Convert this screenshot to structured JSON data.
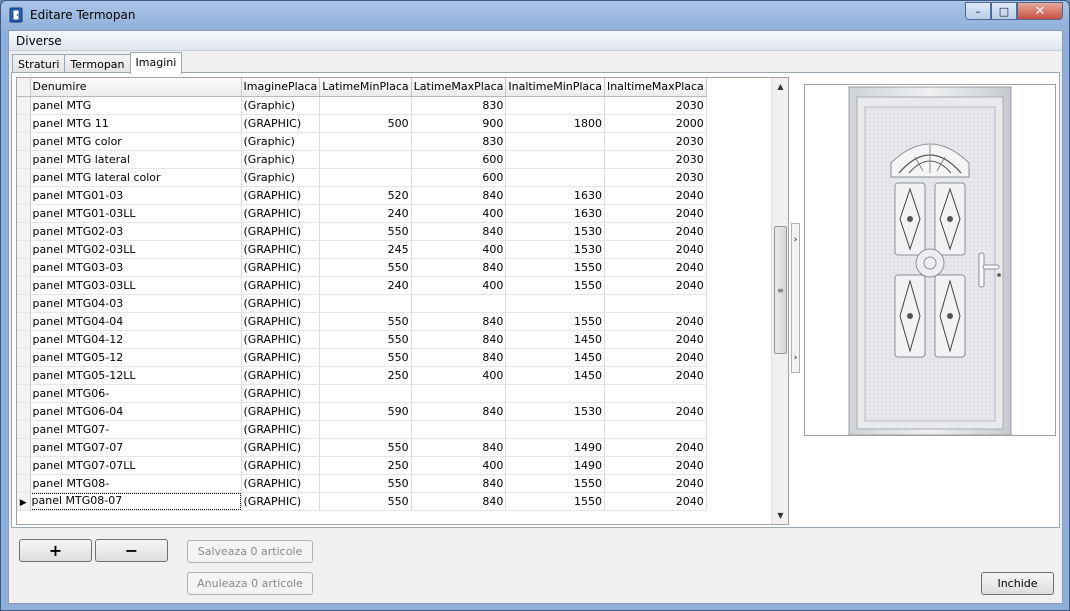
{
  "window": {
    "title": "Editare Termopan",
    "minimize_glyph": "–",
    "maximize_glyph": "□",
    "close_glyph": "✕"
  },
  "menu": {
    "items": [
      "Diverse"
    ]
  },
  "tabs": [
    {
      "label": "Straturi",
      "active": false
    },
    {
      "label": "Termopan",
      "active": false
    },
    {
      "label": "Imagini",
      "active": true
    }
  ],
  "grid": {
    "columns": [
      "Denumire",
      "ImaginePlaca",
      "LatimeMinPlaca",
      "LatimeMaxPlaca",
      "InaltimeMinPlaca",
      "InaltimeMaxPlaca"
    ],
    "selected_row": 22,
    "rows": [
      [
        "panel MTG",
        "(Graphic)",
        "",
        "830",
        "",
        "2030"
      ],
      [
        "panel MTG 11",
        "(GRAPHIC)",
        "500",
        "900",
        "1800",
        "2000"
      ],
      [
        "panel MTG color",
        "(Graphic)",
        "",
        "830",
        "",
        "2030"
      ],
      [
        "panel MTG lateral",
        "(Graphic)",
        "",
        "600",
        "",
        "2030"
      ],
      [
        "panel MTG lateral color",
        "(Graphic)",
        "",
        "600",
        "",
        "2030"
      ],
      [
        "panel MTG01-03",
        "(GRAPHIC)",
        "520",
        "840",
        "1630",
        "2040"
      ],
      [
        "panel MTG01-03LL",
        "(GRAPHIC)",
        "240",
        "400",
        "1630",
        "2040"
      ],
      [
        "panel MTG02-03",
        "(GRAPHIC)",
        "550",
        "840",
        "1530",
        "2040"
      ],
      [
        "panel MTG02-03LL",
        "(GRAPHIC)",
        "245",
        "400",
        "1530",
        "2040"
      ],
      [
        "panel MTG03-03",
        "(GRAPHIC)",
        "550",
        "840",
        "1550",
        "2040"
      ],
      [
        "panel MTG03-03LL",
        "(GRAPHIC)",
        "240",
        "400",
        "1550",
        "2040"
      ],
      [
        "panel MTG04-03",
        "(GRAPHIC)",
        "",
        "",
        "",
        ""
      ],
      [
        "panel MTG04-04",
        "(GRAPHIC)",
        "550",
        "840",
        "1550",
        "2040"
      ],
      [
        "panel MTG04-12",
        "(GRAPHIC)",
        "550",
        "840",
        "1450",
        "2040"
      ],
      [
        "panel MTG05-12",
        "(GRAPHIC)",
        "550",
        "840",
        "1450",
        "2040"
      ],
      [
        "panel MTG05-12LL",
        "(GRAPHIC)",
        "250",
        "400",
        "1450",
        "2040"
      ],
      [
        "panel MTG06-",
        "(GRAPHIC)",
        "",
        "",
        "",
        ""
      ],
      [
        "panel MTG06-04",
        "(GRAPHIC)",
        "590",
        "840",
        "1530",
        "2040"
      ],
      [
        "panel MTG07-",
        "(GRAPHIC)",
        "",
        "",
        "",
        ""
      ],
      [
        "panel MTG07-07",
        "(GRAPHIC)",
        "550",
        "840",
        "1490",
        "2040"
      ],
      [
        "panel MTG07-07LL",
        "(GRAPHIC)",
        "250",
        "400",
        "1490",
        "2040"
      ],
      [
        "panel MTG08-",
        "(GRAPHIC)",
        "550",
        "840",
        "1550",
        "2040"
      ],
      [
        "panel MTG08-07",
        "(GRAPHIC)",
        "550",
        "840",
        "1550",
        "2040"
      ]
    ]
  },
  "buttons": {
    "add": "+",
    "remove": "−",
    "save": "Salveaza 0 articole",
    "cancel": "Anuleaza 0 articole",
    "close": "Inchide"
  },
  "icons": {
    "app": "door-app-icon",
    "row_pointer": "▶",
    "scroll_up": "▲",
    "scroll_down": "▼",
    "scroll_grip": "≡",
    "splitter_arrow": "›"
  },
  "colors": {
    "title_bar": "#8fb0da",
    "close_button": "#c85040"
  }
}
